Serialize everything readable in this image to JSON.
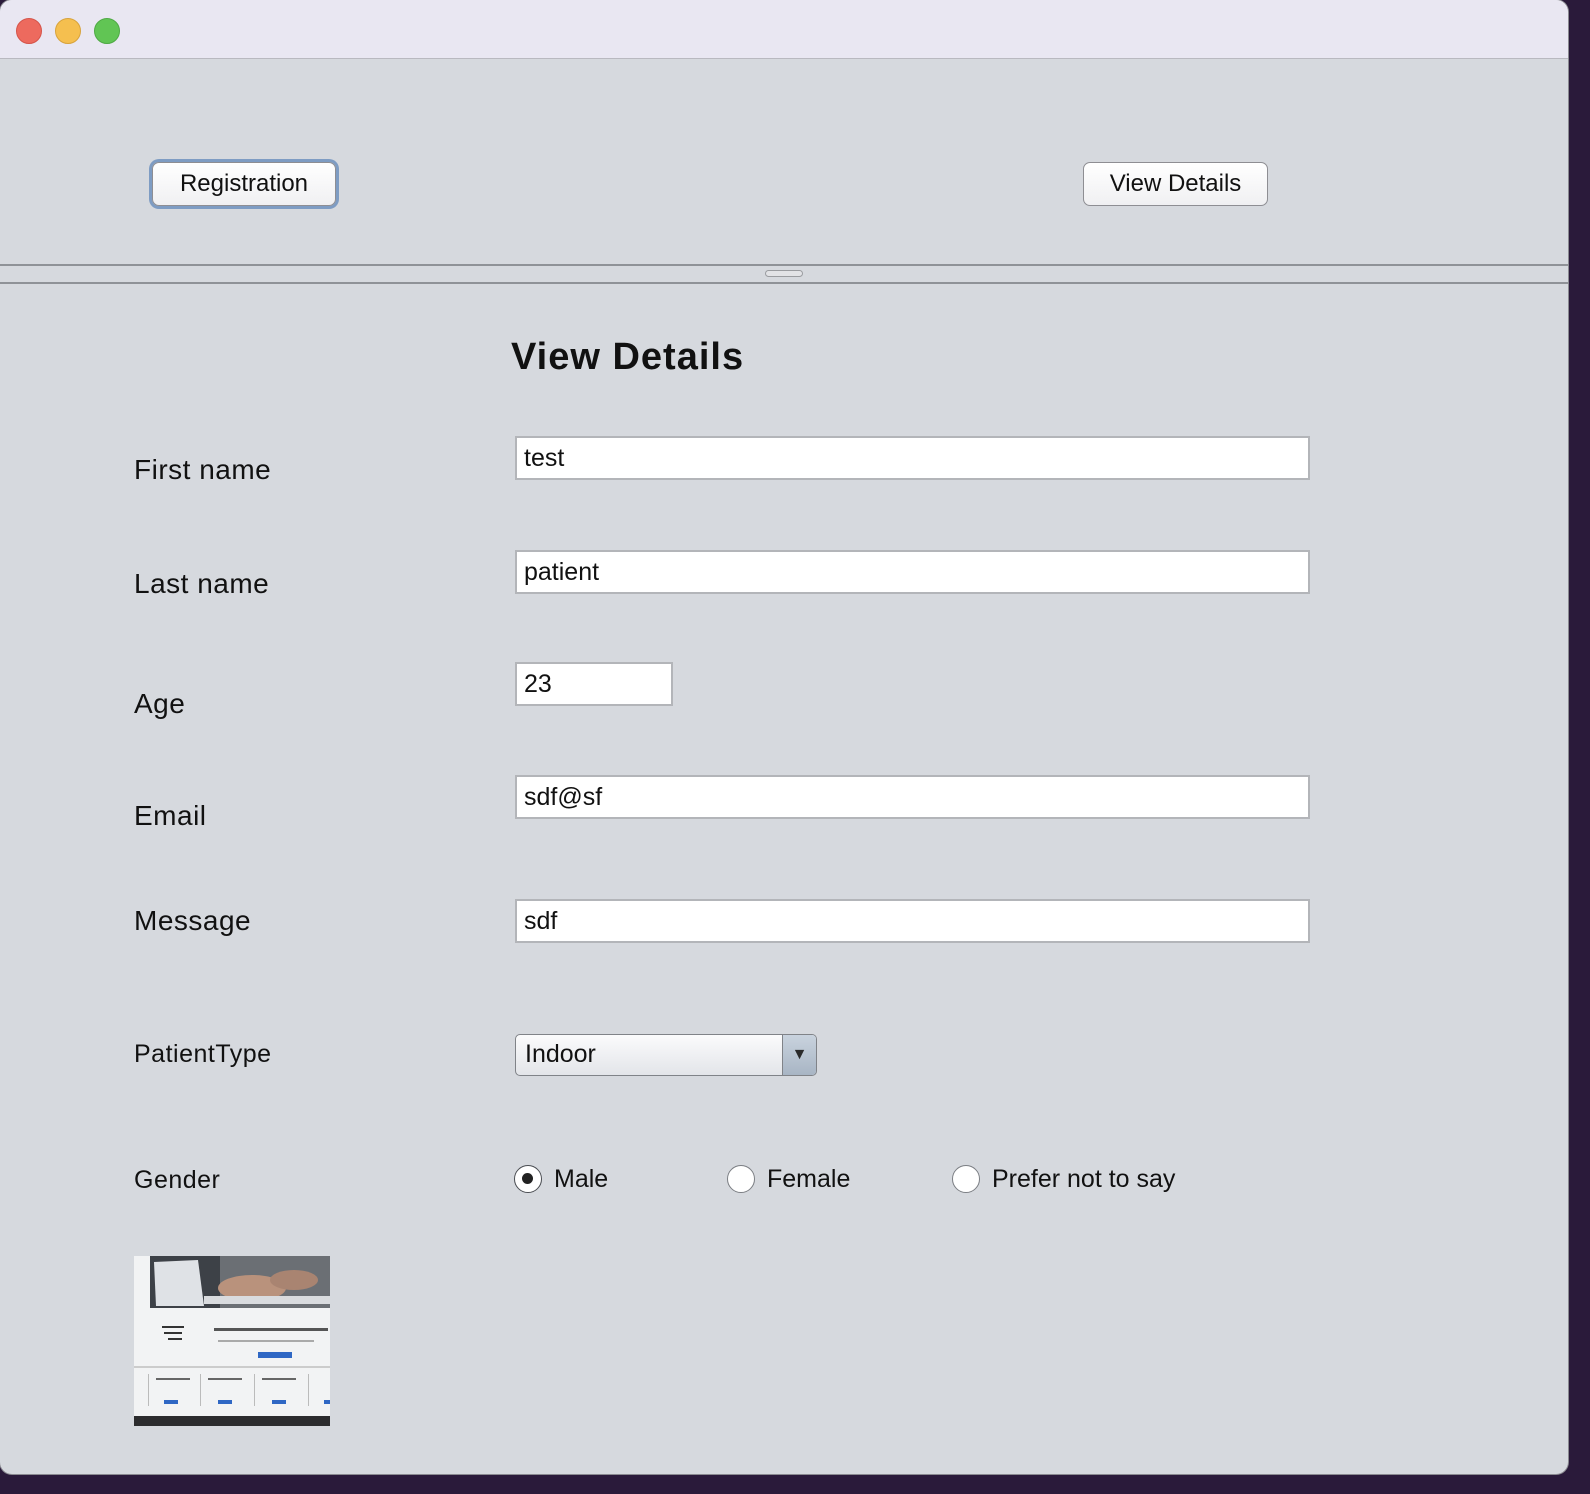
{
  "window": {
    "controls": [
      "close-icon",
      "minimize-icon",
      "zoom-icon"
    ]
  },
  "toolbar": {
    "registration_label": "Registration",
    "view_details_label": "View Details"
  },
  "form": {
    "heading": "View Details",
    "first_name": {
      "label": "First name",
      "value": "test"
    },
    "last_name": {
      "label": "Last name",
      "value": "patient"
    },
    "age": {
      "label": "Age",
      "value": "23"
    },
    "email": {
      "label": "Email",
      "value": "sdf@sf"
    },
    "message": {
      "label": "Message",
      "value": "sdf"
    },
    "patient_type": {
      "label": "PatientType",
      "value": "Indoor"
    },
    "gender": {
      "label": "Gender",
      "options": [
        "Male",
        "Female",
        "Prefer not to say"
      ],
      "selected": "Male"
    }
  },
  "colors": {
    "window_bg": "#d6d9de",
    "title_bar": "#e9e7f2",
    "focus_ring": "#7e9cc3"
  }
}
